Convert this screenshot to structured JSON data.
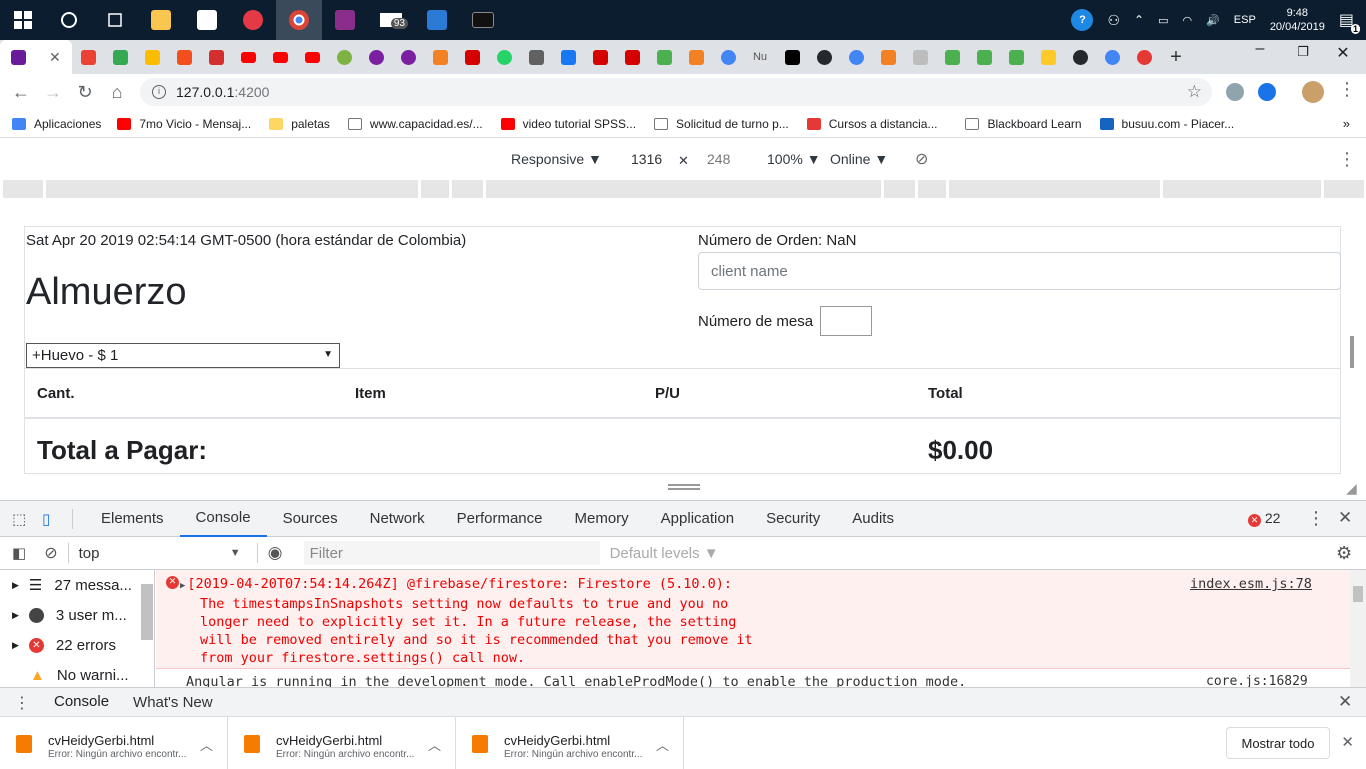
{
  "taskbar": {
    "time": "9:48",
    "date": "20/04/2019",
    "lang": "ESP",
    "mail_badge": "93",
    "notif_badge": "1"
  },
  "browser": {
    "url_host": "127.0.0.1",
    "url_port": ":4200",
    "bookmarks": [
      {
        "label": "Aplicaciones",
        "color": "#4285f4"
      },
      {
        "label": "7mo Vicio - Mensaj...",
        "color": "#ff0000"
      },
      {
        "label": "paletas",
        "color": "#fbc02d"
      },
      {
        "label": "www.capacidad.es/...",
        "color": "#9e9e9e"
      },
      {
        "label": "video tutorial SPSS...",
        "color": "#ff0000"
      },
      {
        "label": "Solicitud de turno p...",
        "color": "#9e9e9e"
      },
      {
        "label": "Cursos a distancia...",
        "color": "#e53935"
      },
      {
        "label": "Blackboard Learn",
        "color": "#9e9e9e"
      },
      {
        "label": "busuu.com - Piacer...",
        "color": "#1565c0"
      }
    ]
  },
  "devbar": {
    "mode": "Responsive",
    "width": "1316",
    "height": "248",
    "zoom": "100%",
    "network": "Online"
  },
  "app": {
    "date": "Sat Apr 20 2019 02:54:14 GMT-0500 (hora estándar de Colombia)",
    "title": "Almuerzo",
    "selected_item": "+Huevo - $ 1",
    "order_label": "Número de Orden: NaN",
    "client_placeholder": "client name",
    "table_label": "Número de mesa",
    "columns": [
      "Cant.",
      "Item",
      "P/U",
      "Total"
    ],
    "total_label": "Total a Pagar:",
    "total_value": "$0.00"
  },
  "devtools": {
    "tabs": [
      "Elements",
      "Console",
      "Sources",
      "Network",
      "Performance",
      "Memory",
      "Application",
      "Security",
      "Audits"
    ],
    "active_tab": "Console",
    "error_count": "22",
    "context": "top",
    "filter_placeholder": "Filter",
    "levels": "Default levels",
    "sidebar": [
      "27 messa...",
      "3 user m...",
      "22 errors",
      "No warni..."
    ],
    "error_line1": "[2019-04-20T07:54:14.264Z]  @firebase/firestore: Firestore (5.10.0):",
    "error_line2": "The timestampsInSnapshots setting now defaults to true and you no",
    "error_line3": "longer need to explicitly set it. In a future release, the setting",
    "error_line4": "will be removed entirely and so it is recommended that you remove it",
    "error_line5": "from your firestore.settings() call now.",
    "error_source": "index.esm.js:78",
    "info_line": "Angular is running in the development mode. Call enableProdMode() to enable the production mode.",
    "info_source": "core.js:16829",
    "drawer_tabs": [
      "Console",
      "What's New"
    ]
  },
  "downloads": {
    "items": [
      {
        "name": "cvHeidyGerbi.html",
        "status": "Error: Ningún archivo encontr..."
      },
      {
        "name": "cvHeidyGerbi.html",
        "status": "Error: Ningún archivo encontr..."
      },
      {
        "name": "cvHeidyGerbi.html",
        "status": "Error: Ningún archivo encontr..."
      }
    ],
    "show_all": "Mostrar todo"
  },
  "colors": {
    "accent": "#1a73e8",
    "error": "#e00000",
    "taskbar": "#0b1d2e"
  }
}
